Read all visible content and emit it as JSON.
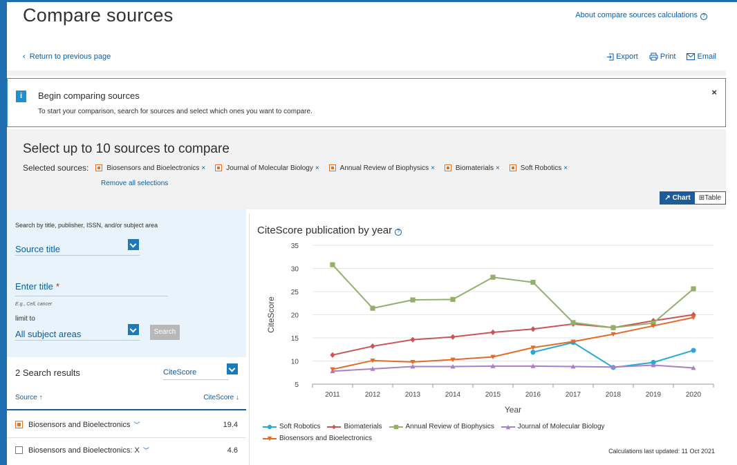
{
  "header": {
    "title": "Compare sources",
    "about_link": "About compare sources calculations",
    "return_link": "Return to previous page",
    "export_label": "Export",
    "print_label": "Print",
    "email_label": "Email"
  },
  "info": {
    "icon": "i",
    "title": "Begin comparing sources",
    "text": "To start your comparison, search for sources and select which ones you want to compare.",
    "close": "×"
  },
  "selection": {
    "title": "Select up to 10 sources to compare",
    "label": "Selected sources:",
    "sources": [
      "Biosensors and Bioelectronics",
      "Journal of Molecular Biology",
      "Annual Review of Biophysics",
      "Biomaterials",
      "Soft Robotics"
    ],
    "remove_icon": "×",
    "remove_all": "Remove all selections",
    "chart_label": "Chart",
    "table_label": "Table"
  },
  "search": {
    "label": "Search by title, publisher, ISSN, and/or subject area",
    "field_type": "Source title",
    "enter_title": "Enter title",
    "required_mark": "*",
    "example": "E.g., Cell, cancer",
    "limit_to": "limit to",
    "subject": "All subject areas",
    "search_button": "Search"
  },
  "results": {
    "count": "2 Search results",
    "sort_field": "CiteScore",
    "col_source": "Source",
    "col_citescore": "CiteScore",
    "rows": [
      {
        "name": "Biosensors and Bioelectronics",
        "value": "19.4",
        "checked": true
      },
      {
        "name": "Biosensors and Bioelectronics: X",
        "value": "4.6",
        "checked": false
      }
    ]
  },
  "chart_data": {
    "type": "line",
    "title": "CiteScore publication by year",
    "xlabel": "Year",
    "ylabel": "CiteScore",
    "ylim": [
      5,
      35
    ],
    "yticks": [
      5,
      10,
      15,
      20,
      25,
      30,
      35
    ],
    "x": [
      2011,
      2012,
      2013,
      2014,
      2015,
      2016,
      2017,
      2018,
      2019,
      2020
    ],
    "series": [
      {
        "name": "Soft Robotics",
        "color": "#26a9d4",
        "marker": "circle",
        "values": [
          null,
          null,
          null,
          null,
          null,
          11.9,
          14.0,
          8.6,
          9.7,
          12.3
        ]
      },
      {
        "name": "Biomaterials",
        "color": "#c95556",
        "marker": "diamond",
        "values": [
          11.3,
          13.2,
          14.6,
          15.2,
          16.2,
          16.9,
          18.0,
          17.2,
          18.7,
          20.0
        ]
      },
      {
        "name": "Annual Review of Biophysics",
        "color": "#93b06b",
        "marker": "square",
        "values": [
          30.8,
          21.4,
          23.2,
          23.3,
          28.1,
          27.0,
          18.3,
          17.2,
          18.2,
          25.6
        ]
      },
      {
        "name": "Journal of Molecular Biology",
        "color": "#a97fc7",
        "marker": "triangle",
        "values": [
          7.8,
          8.3,
          8.8,
          8.8,
          8.9,
          8.9,
          8.8,
          8.7,
          9.1,
          8.5
        ]
      },
      {
        "name": "Biosensors and Bioelectronics",
        "color": "#e36a28",
        "marker": "triangle-down",
        "values": [
          8.2,
          10.1,
          9.8,
          10.3,
          10.9,
          12.9,
          14.2,
          15.8,
          17.6,
          19.4
        ]
      }
    ],
    "grid": true,
    "legend": "bottom"
  },
  "footer": {
    "calc_updated": "Calculations last updated: 11 Oct 2021"
  }
}
